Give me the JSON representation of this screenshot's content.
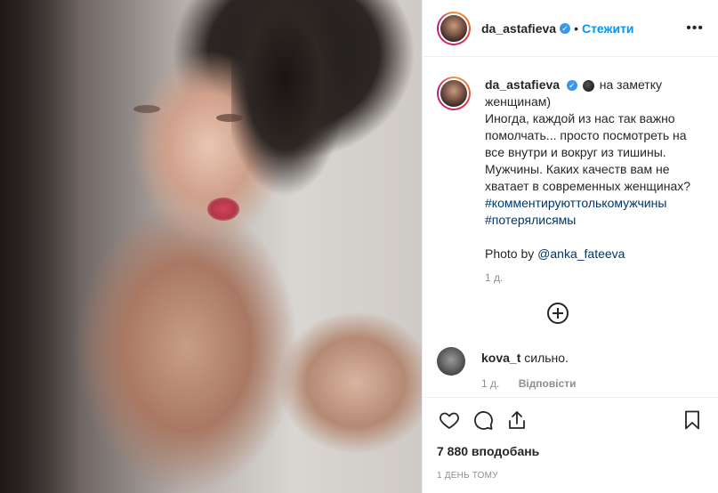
{
  "header": {
    "username": "da_astafieva",
    "separator": "•",
    "follow_label": "Стежити",
    "more_label": "•••"
  },
  "caption": {
    "username": "da_astafieva",
    "line1": "на заметку женщинам)",
    "line2": "Иногда, каждой из нас так важно помолчать... просто посмотреть на все внутри и вокруг из тишины.",
    "line3": "Мужчины. Каких качеств вам не хватает в современных женщинах?",
    "hashtag1": "#комментируюттолькомужчины",
    "hashtag2": "#потерялисямы",
    "photo_by": "Photo by",
    "mention": "@anka_fateeva",
    "time": "1 д."
  },
  "comment": {
    "username": "kova_t",
    "text": "сильно.",
    "time": "1 д.",
    "reply_label": "Відповісти"
  },
  "actions": {
    "likes": "7 880 вподобань",
    "posted": "1 ДЕНЬ ТОМУ"
  },
  "colors": {
    "link": "#0095f6",
    "verified": "#3897f0",
    "hashtag": "#00376b",
    "muted": "#8e8e8e"
  },
  "icons": [
    "verified-badge-icon",
    "more-options-icon",
    "moon-emoji-icon",
    "load-more-comments-icon",
    "heart-icon",
    "comment-icon",
    "share-icon",
    "bookmark-icon"
  ]
}
